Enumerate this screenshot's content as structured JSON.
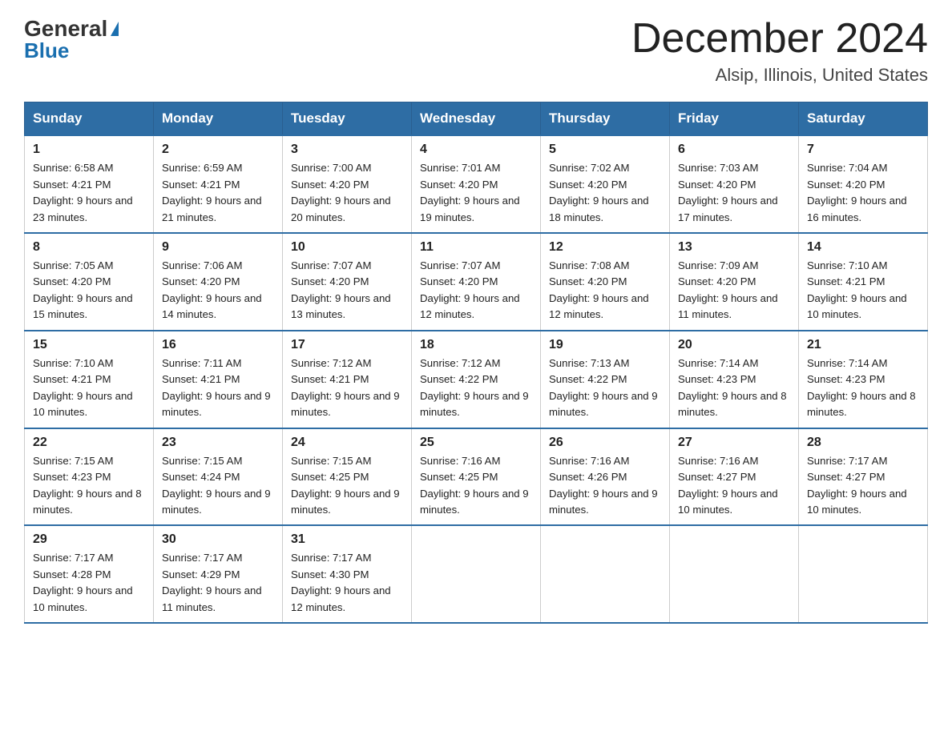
{
  "header": {
    "logo_general": "General",
    "logo_blue": "Blue",
    "month_title": "December 2024",
    "location": "Alsip, Illinois, United States"
  },
  "days_of_week": [
    "Sunday",
    "Monday",
    "Tuesday",
    "Wednesday",
    "Thursday",
    "Friday",
    "Saturday"
  ],
  "weeks": [
    [
      {
        "day": "1",
        "sunrise": "6:58 AM",
        "sunset": "4:21 PM",
        "daylight": "9 hours and 23 minutes."
      },
      {
        "day": "2",
        "sunrise": "6:59 AM",
        "sunset": "4:21 PM",
        "daylight": "9 hours and 21 minutes."
      },
      {
        "day": "3",
        "sunrise": "7:00 AM",
        "sunset": "4:20 PM",
        "daylight": "9 hours and 20 minutes."
      },
      {
        "day": "4",
        "sunrise": "7:01 AM",
        "sunset": "4:20 PM",
        "daylight": "9 hours and 19 minutes."
      },
      {
        "day": "5",
        "sunrise": "7:02 AM",
        "sunset": "4:20 PM",
        "daylight": "9 hours and 18 minutes."
      },
      {
        "day": "6",
        "sunrise": "7:03 AM",
        "sunset": "4:20 PM",
        "daylight": "9 hours and 17 minutes."
      },
      {
        "day": "7",
        "sunrise": "7:04 AM",
        "sunset": "4:20 PM",
        "daylight": "9 hours and 16 minutes."
      }
    ],
    [
      {
        "day": "8",
        "sunrise": "7:05 AM",
        "sunset": "4:20 PM",
        "daylight": "9 hours and 15 minutes."
      },
      {
        "day": "9",
        "sunrise": "7:06 AM",
        "sunset": "4:20 PM",
        "daylight": "9 hours and 14 minutes."
      },
      {
        "day": "10",
        "sunrise": "7:07 AM",
        "sunset": "4:20 PM",
        "daylight": "9 hours and 13 minutes."
      },
      {
        "day": "11",
        "sunrise": "7:07 AM",
        "sunset": "4:20 PM",
        "daylight": "9 hours and 12 minutes."
      },
      {
        "day": "12",
        "sunrise": "7:08 AM",
        "sunset": "4:20 PM",
        "daylight": "9 hours and 12 minutes."
      },
      {
        "day": "13",
        "sunrise": "7:09 AM",
        "sunset": "4:20 PM",
        "daylight": "9 hours and 11 minutes."
      },
      {
        "day": "14",
        "sunrise": "7:10 AM",
        "sunset": "4:21 PM",
        "daylight": "9 hours and 10 minutes."
      }
    ],
    [
      {
        "day": "15",
        "sunrise": "7:10 AM",
        "sunset": "4:21 PM",
        "daylight": "9 hours and 10 minutes."
      },
      {
        "day": "16",
        "sunrise": "7:11 AM",
        "sunset": "4:21 PM",
        "daylight": "9 hours and 9 minutes."
      },
      {
        "day": "17",
        "sunrise": "7:12 AM",
        "sunset": "4:21 PM",
        "daylight": "9 hours and 9 minutes."
      },
      {
        "day": "18",
        "sunrise": "7:12 AM",
        "sunset": "4:22 PM",
        "daylight": "9 hours and 9 minutes."
      },
      {
        "day": "19",
        "sunrise": "7:13 AM",
        "sunset": "4:22 PM",
        "daylight": "9 hours and 9 minutes."
      },
      {
        "day": "20",
        "sunrise": "7:14 AM",
        "sunset": "4:23 PM",
        "daylight": "9 hours and 8 minutes."
      },
      {
        "day": "21",
        "sunrise": "7:14 AM",
        "sunset": "4:23 PM",
        "daylight": "9 hours and 8 minutes."
      }
    ],
    [
      {
        "day": "22",
        "sunrise": "7:15 AM",
        "sunset": "4:23 PM",
        "daylight": "9 hours and 8 minutes."
      },
      {
        "day": "23",
        "sunrise": "7:15 AM",
        "sunset": "4:24 PM",
        "daylight": "9 hours and 9 minutes."
      },
      {
        "day": "24",
        "sunrise": "7:15 AM",
        "sunset": "4:25 PM",
        "daylight": "9 hours and 9 minutes."
      },
      {
        "day": "25",
        "sunrise": "7:16 AM",
        "sunset": "4:25 PM",
        "daylight": "9 hours and 9 minutes."
      },
      {
        "day": "26",
        "sunrise": "7:16 AM",
        "sunset": "4:26 PM",
        "daylight": "9 hours and 9 minutes."
      },
      {
        "day": "27",
        "sunrise": "7:16 AM",
        "sunset": "4:27 PM",
        "daylight": "9 hours and 10 minutes."
      },
      {
        "day": "28",
        "sunrise": "7:17 AM",
        "sunset": "4:27 PM",
        "daylight": "9 hours and 10 minutes."
      }
    ],
    [
      {
        "day": "29",
        "sunrise": "7:17 AM",
        "sunset": "4:28 PM",
        "daylight": "9 hours and 10 minutes."
      },
      {
        "day": "30",
        "sunrise": "7:17 AM",
        "sunset": "4:29 PM",
        "daylight": "9 hours and 11 minutes."
      },
      {
        "day": "31",
        "sunrise": "7:17 AM",
        "sunset": "4:30 PM",
        "daylight": "9 hours and 12 minutes."
      },
      null,
      null,
      null,
      null
    ]
  ]
}
